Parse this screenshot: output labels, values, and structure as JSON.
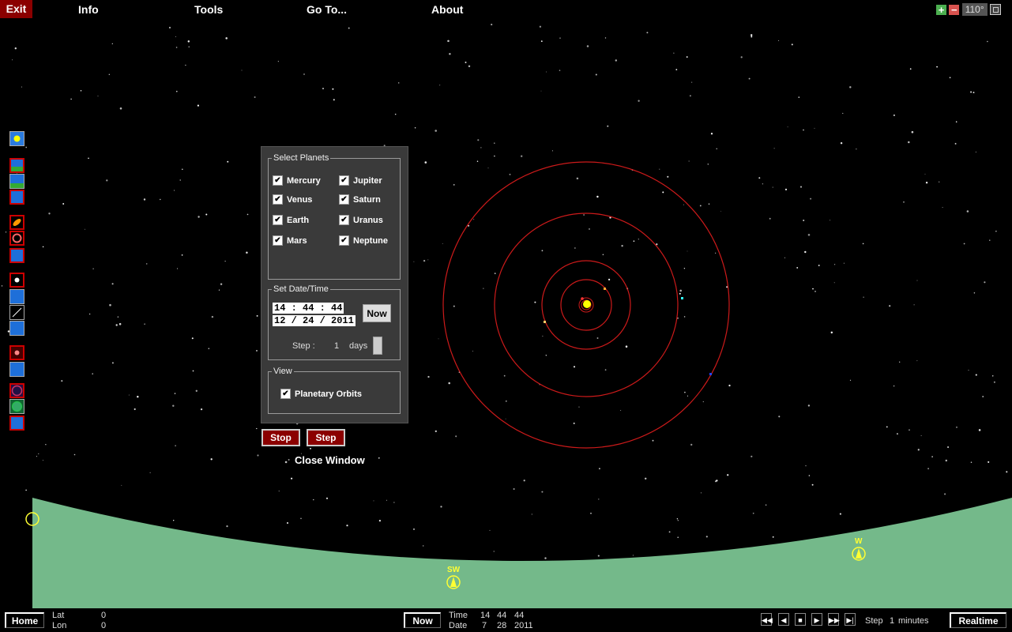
{
  "menu": {
    "exit": "Exit",
    "info": "Info",
    "tools": "Tools",
    "goto": "Go To...",
    "about": "About"
  },
  "zoom": {
    "in": "+",
    "out": "−",
    "value": "110°"
  },
  "planets_panel": {
    "select_title": "Select Planets",
    "planets": [
      {
        "label": "Mercury",
        "checked": true
      },
      {
        "label": "Venus",
        "checked": true
      },
      {
        "label": "Earth",
        "checked": true
      },
      {
        "label": "Mars",
        "checked": true
      },
      {
        "label": "Jupiter",
        "checked": true
      },
      {
        "label": "Saturn",
        "checked": true
      },
      {
        "label": "Uranus",
        "checked": true
      },
      {
        "label": "Neptune",
        "checked": true
      }
    ],
    "datetime_title": "Set Date/Time",
    "time_value": "14 : 44 : 44",
    "date_value": "12 / 24 /  2011",
    "now_label": "Now",
    "step_label": "Step :",
    "step_value": "1",
    "step_unit": "days",
    "view_title": "View",
    "orbits_label": "Planetary Orbits",
    "stop_label": "Stop",
    "step_button": "Step",
    "close_label": "Close Window"
  },
  "horizon": {
    "sw_label": "SW",
    "w_label": "W"
  },
  "bottom": {
    "home": "Home",
    "lat_label": "Lat",
    "lat_value": "0",
    "lon_label": "Lon",
    "lon_value": "0",
    "now": "Now",
    "time_label": "Time",
    "time_h": "14",
    "time_m": "44",
    "time_s": "44",
    "date_label": "Date",
    "date_m": "7",
    "date_d": "28",
    "date_y": "2011",
    "step_label": "Step",
    "step_value": "1",
    "step_unit": "minutes",
    "realtime": "Realtime"
  },
  "colors": {
    "orbit": "#cc1a1a",
    "ground": "#74b98a",
    "exit_bg": "#8b0000",
    "sun": "#ffff00"
  }
}
